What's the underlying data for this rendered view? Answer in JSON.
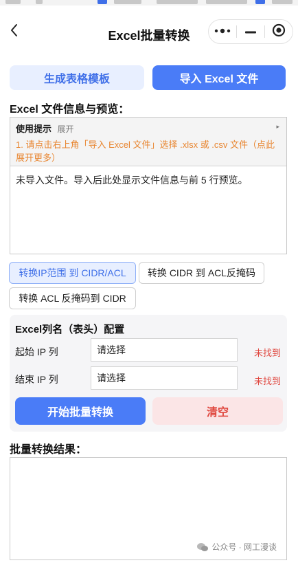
{
  "nav": {
    "title": "Excel批量转换"
  },
  "tabs": [
    {
      "label": "生成表格模板"
    },
    {
      "label": "导入 Excel 文件"
    }
  ],
  "file_section": {
    "heading": "Excel 文件信息与预览：",
    "tips_title": "使用提示",
    "tips_expand": "展开",
    "tips_body": "1. 请点击右上角「导入 Excel 文件」选择 .xlsx 或 .csv 文件（点此展开更多）",
    "info_text": "未导入文件。导入后此处显示文件信息与前 5 行预览。"
  },
  "conversion_modes": [
    {
      "label": "转换IP范围 到 CIDR/ACL",
      "active": true
    },
    {
      "label": "转换 CIDR 到 ACL反掩码",
      "active": false
    },
    {
      "label": "转换 ACL 反掩码到 CIDR",
      "active": false
    }
  ],
  "config": {
    "title": "Excel列名（表头）配置",
    "rows": [
      {
        "label": "起始 IP 列",
        "value": "请选择",
        "status": "未找到"
      },
      {
        "label": "结束 IP 列",
        "value": "请选择",
        "status": "未找到"
      }
    ],
    "start_label": "开始批量转换",
    "clear_label": "清空"
  },
  "results": {
    "heading": "批量转换结果："
  },
  "watermark": {
    "text": "公众号 · 网工漫谈"
  },
  "colors": {
    "primary": "#4a7cf7",
    "primary_light": "#e8efff",
    "danger": "#e0473f",
    "danger_light": "#fbe5e6",
    "tip_orange": "#e8852f"
  }
}
